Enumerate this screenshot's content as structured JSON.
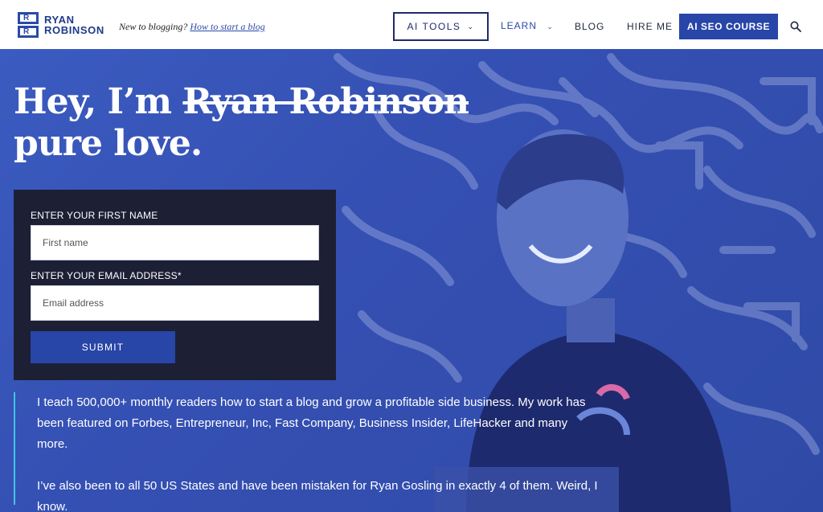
{
  "header": {
    "logo_line1": "RYAN",
    "logo_line2": "ROBINSON",
    "tagline_prefix": "New to blogging?",
    "tagline_link": "How to start a blog",
    "nav": {
      "ai_tools": "AI TOOLS",
      "learn": "LEARN",
      "blog": "BLOG",
      "hire_me": "HIRE ME",
      "course": "AI SEO COURSE"
    },
    "search_icon": "search-icon"
  },
  "hero": {
    "headline_prefix": "Hey, I’m ",
    "headline_strike": "Ryan Robinson",
    "headline_line2": "pure love.",
    "form": {
      "first_name_label": "ENTER YOUR FIRST NAME",
      "first_name_placeholder": "First name",
      "email_label": "ENTER YOUR EMAIL ADDRESS*",
      "email_placeholder": "Email address",
      "submit_label": "SUBMIT"
    },
    "paragraph1": "I teach 500,000+ monthly readers how to start a blog and grow a profitable side business. My work has been featured on Forbes, Entrepreneur, Inc, Fast Company, Business Insider, LifeHacker and many more.",
    "paragraph2": "I’ve also been to all 50 US States and have been mistaken for Ryan Gosling in exactly 4 of them. Weird, I know."
  },
  "colors": {
    "brand": "#2845a8",
    "form_bg": "#1d1f35",
    "accent_line": "#40c4e8"
  }
}
